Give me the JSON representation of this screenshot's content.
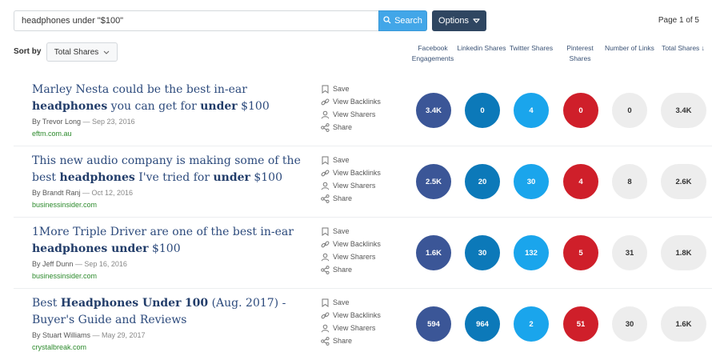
{
  "search": {
    "query": "headphones under \"$100\"",
    "button_label": "Search"
  },
  "options": {
    "label": "Options"
  },
  "pagination": {
    "label": "Page 1 of 5"
  },
  "sort": {
    "label": "Sort by",
    "selected": "Total Shares"
  },
  "columns": {
    "facebook": "Facebook Engagements",
    "linkedin": "Linkedin Shares",
    "twitter": "Twitter Shares",
    "pinterest": "Pinterest Shares",
    "links": "Number of Links",
    "total": "Total Shares ↓"
  },
  "action_labels": {
    "save": "Save",
    "backlinks": "View Backlinks",
    "sharers": "View Sharers",
    "share": "Share"
  },
  "rows": [
    {
      "title_parts": [
        {
          "text": "Marley Nesta could be the best in-ear ",
          "bold": false
        },
        {
          "text": "headphones",
          "bold": true
        },
        {
          "text": " you can get for ",
          "bold": false
        },
        {
          "text": "under",
          "bold": true
        },
        {
          "text": " $100",
          "bold": false
        }
      ],
      "author": "By Trevor Long",
      "date": " — Sep 23, 2016",
      "domain": "eftm.com.au",
      "facebook": "3.4K",
      "linkedin": "0",
      "twitter": "4",
      "pinterest": "0",
      "links": "0",
      "total": "3.4K"
    },
    {
      "title_parts": [
        {
          "text": "This new audio company is making some of the best ",
          "bold": false
        },
        {
          "text": "headphones",
          "bold": true
        },
        {
          "text": " I've tried for ",
          "bold": false
        },
        {
          "text": "under",
          "bold": true
        },
        {
          "text": " $100",
          "bold": false
        }
      ],
      "author": "By Brandt Ranj",
      "date": " — Oct 12, 2016",
      "domain": "businessinsider.com",
      "facebook": "2.5K",
      "linkedin": "20",
      "twitter": "30",
      "pinterest": "4",
      "links": "8",
      "total": "2.6K"
    },
    {
      "title_parts": [
        {
          "text": "1More Triple Driver are one of the best in-ear ",
          "bold": false
        },
        {
          "text": "headphones under",
          "bold": true
        },
        {
          "text": " $100",
          "bold": false
        }
      ],
      "author": "By Jeff Dunn",
      "date": " — Sep 16, 2016",
      "domain": "businessinsider.com",
      "facebook": "1.6K",
      "linkedin": "30",
      "twitter": "132",
      "pinterest": "5",
      "links": "31",
      "total": "1.8K"
    },
    {
      "title_parts": [
        {
          "text": "Best ",
          "bold": false
        },
        {
          "text": "Headphones Under",
          "bold": true
        },
        {
          "text": " ",
          "bold": false
        },
        {
          "text": "100",
          "bold": true
        },
        {
          "text": " (Aug. 2017) - Buyer's Guide and Reviews",
          "bold": false
        }
      ],
      "author": "By Stuart Williams",
      "date": " — May 29, 2017",
      "domain": "crystalbreak.com",
      "facebook": "594",
      "linkedin": "964",
      "twitter": "2",
      "pinterest": "51",
      "links": "30",
      "total": "1.6K"
    }
  ],
  "colors": {
    "facebook": "#3b5697",
    "linkedin": "#0c79b9",
    "twitter": "#1aa5ec",
    "pinterest": "#cf1f2a",
    "neutral": "#ededed",
    "search_button": "#42a6e8",
    "options_button": "#2f4661"
  }
}
